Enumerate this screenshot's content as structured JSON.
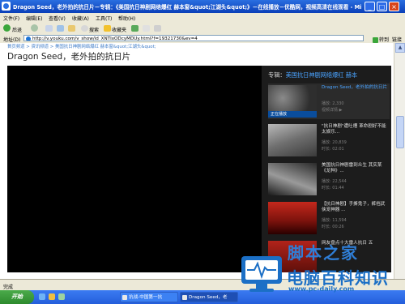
{
  "window": {
    "title": "Dragon Seed，老外拍的抗日片－专辑：《美国抗日神剧网络爆红 赫本窗&quot;江湖头&quot;》－在线播放－优酷网，视频高清在线观看 - Microsoft Internet Explorer",
    "minimize": "_",
    "maximize": "□",
    "close": "×"
  },
  "menu": [
    "文件(F)",
    "编辑(E)",
    "查看(V)",
    "收藏(A)",
    "工具(T)",
    "帮助(H)"
  ],
  "toolbar": {
    "back": "后退",
    "search": "搜索",
    "favorites": "收藏夹"
  },
  "address": {
    "label": "地址(D)",
    "url": "http://v.youku.com/v_show/id_XNTIxODcyMDUy.html?f=19321730&ev=4",
    "go": "转到",
    "links": "链接"
  },
  "page": {
    "breadcrumb": "首页频道 > 资讯频道 > 美国抗日神剧网络爆红 赫本窗&quot;江湖头&quot;",
    "title": "Dragon Seed，老外拍的抗日片"
  },
  "playlist": {
    "label": "专辑：",
    "name": "美国抗日神剧网络爆红 赫本",
    "items": [
      {
        "title": "Dragon Seed，老外拍的抗日片",
        "caption": "正在播放",
        "meta1": "播放: 2,330",
        "meta2": "视频详情 ▶",
        "active": true
      },
      {
        "title": "\"抗日神剧\"遭吐槽 革命剧好不能太娱乐...",
        "caption": "",
        "meta1": "播放: 20,839",
        "meta2": "时长: 02:01",
        "active": false
      },
      {
        "title": "美国抗日神剧雷到众生 其实某《龙种》...",
        "caption": "",
        "meta1": "播放: 22,544",
        "meta2": "时长: 01:44",
        "active": false
      },
      {
        "title": "【抗日神剧】手撕鬼子，裤裆武侠宠神器 ...",
        "caption": "",
        "meta1": "播放: 11,594",
        "meta2": "时长: 00:26",
        "active": false
      },
      {
        "title": "网友盘点十大雷人抗日 五",
        "caption": "",
        "meta1": "",
        "meta2": "",
        "active": false
      }
    ]
  },
  "status": {
    "text": "完成"
  },
  "taskbar": {
    "start": "开始",
    "tasks": [
      "抗战-中国第一抗",
      "Dragon Seed，老"
    ]
  },
  "watermark": {
    "line1": "脚本之家",
    "line2": "电脑百科知识",
    "url": "www.pc-daily.com"
  }
}
